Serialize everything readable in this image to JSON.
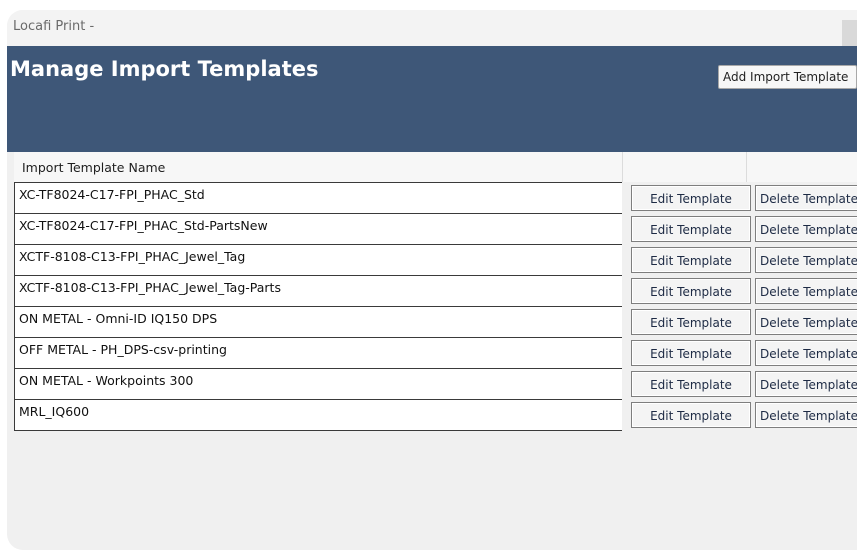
{
  "window": {
    "title": "Locafi Print -"
  },
  "header": {
    "title": "Manage Import Templates",
    "add_button_label": "Add Import Template"
  },
  "grid": {
    "columns": [
      "Import Template Name",
      "",
      ""
    ],
    "rows": [
      {
        "name": "XC-TF8024-C17-FPI_PHAC_Std",
        "edit_label": "Edit Template",
        "delete_label": "Delete Template"
      },
      {
        "name": "XC-TF8024-C17-FPI_PHAC_Std-PartsNew",
        "edit_label": "Edit Template",
        "delete_label": "Delete Template"
      },
      {
        "name": "XCTF-8108-C13-FPI_PHAC_Jewel_Tag",
        "edit_label": "Edit Template",
        "delete_label": "Delete Template"
      },
      {
        "name": "XCTF-8108-C13-FPI_PHAC_Jewel_Tag-Parts",
        "edit_label": "Edit Template",
        "delete_label": "Delete Template"
      },
      {
        "name": "ON METAL - Omni-ID IQ150 DPS",
        "edit_label": "Edit Template",
        "delete_label": "Delete Template"
      },
      {
        "name": "OFF METAL - PH_DPS-csv-printing",
        "edit_label": "Edit Template",
        "delete_label": "Delete Template"
      },
      {
        "name": "ON METAL - Workpoints 300",
        "edit_label": "Edit Template",
        "delete_label": "Delete Template"
      },
      {
        "name": "MRL_IQ600",
        "edit_label": "Edit Template",
        "delete_label": "Delete Template"
      }
    ]
  },
  "colors": {
    "header_band": "#3e5778",
    "window_background": "#f0f0f0",
    "row_background": "#ffffff"
  }
}
